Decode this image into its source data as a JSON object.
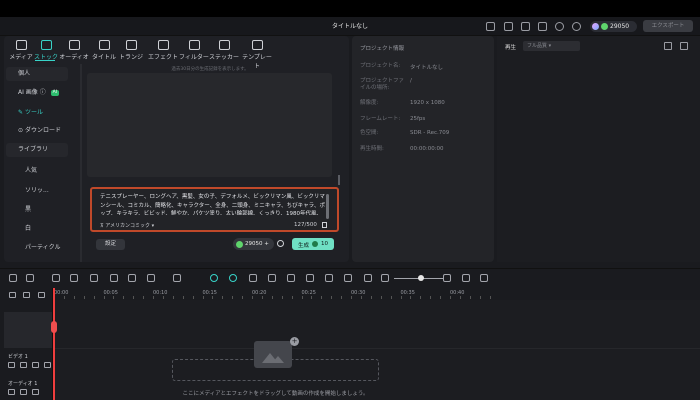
{
  "app": {
    "title": "タイトルなし"
  },
  "header": {
    "credits": "29050",
    "export_label": "エクスポート"
  },
  "toolbar": {
    "items": [
      {
        "label": "メディア",
        "icon": "media-icon"
      },
      {
        "label": "ストック",
        "icon": "stock-icon",
        "active": true
      },
      {
        "label": "オーディオ",
        "icon": "music-icon"
      },
      {
        "label": "タイトル",
        "icon": "text-icon"
      },
      {
        "label": "トランジ",
        "icon": "transition-icon"
      },
      {
        "label": "エフェクト",
        "icon": "effect-icon"
      },
      {
        "label": "フィルター",
        "icon": "filter-icon"
      },
      {
        "label": "ステッカー",
        "icon": "sticker-icon"
      },
      {
        "label": "テンプレート",
        "icon": "template-icon"
      }
    ]
  },
  "sidebar": {
    "personal": "個人",
    "ai_image": "AI 画像",
    "ai_badge": "AI",
    "tool": "ツール",
    "download": "ダウンロード",
    "library": "ライブラリ",
    "library_items": [
      "人気",
      "ソリッ...",
      "黒",
      "白",
      "パーティクル"
    ]
  },
  "generator": {
    "caption": "過去30日分の生成記録を表示します。",
    "prompt": "テニスプレーヤー、ロングヘア、黒髪、女の子、デフォルメ、ビックリマン風、ビックリマンシール、コミカル、簡略化、キャラクター、全身、二頭身、ミニキャラ、ちびキャラ、ポップ、キラキラ、ビビッド、鮮やか、パケツ塗り、太い輪郭線、くっきり、1980年代風、レトロ",
    "style": "アメリカンコミック",
    "char_count": "127/500",
    "settings_label": "設定",
    "cost": "29050",
    "generate_label": "生成",
    "generate_cost": "10"
  },
  "project_info": {
    "heading": "プロジェクト情報",
    "rows": [
      {
        "label": "プロジェクト名:",
        "value": "タイトルなし"
      },
      {
        "label": "プロジェクトファイルの場所:",
        "value": "/"
      },
      {
        "label": "解像度:",
        "value": "1920 x 1080"
      },
      {
        "label": "フレームレート:",
        "value": "25fps"
      },
      {
        "label": "色空間:",
        "value": "SDR - Rec.709"
      },
      {
        "label": "再生時間:",
        "value": "00:00:00:00"
      }
    ]
  },
  "player": {
    "tab": "再生",
    "quality": "フル品質"
  },
  "timeline": {
    "ticks": [
      "00:00",
      "00:05",
      "00:10",
      "00:15",
      "00:20",
      "00:25",
      "00:30",
      "00:35",
      "00:40"
    ],
    "video_track": "ビデオ 1",
    "audio_track": "オーディオ 1",
    "drop_text": "ここにメディアとエフェクトをドラッグして動画の作成を開始しましょう。"
  }
}
